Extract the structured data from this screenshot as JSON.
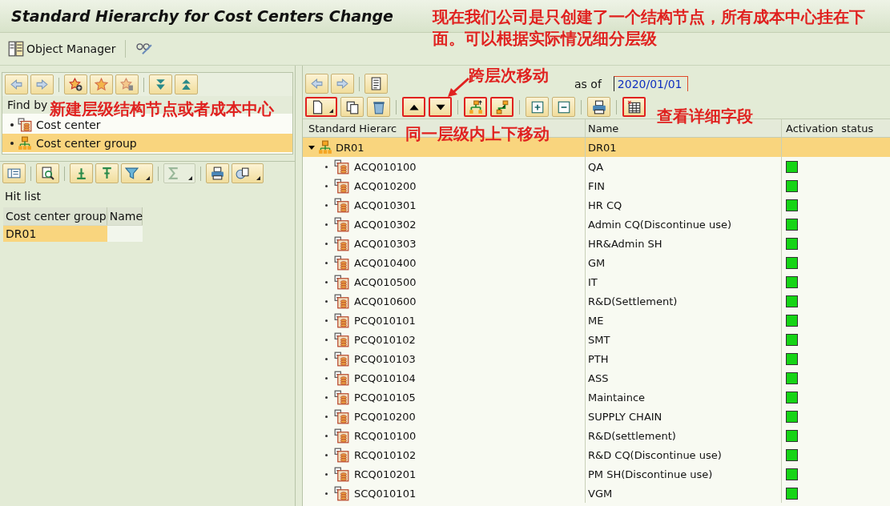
{
  "window": {
    "title": "Standard Hierarchy for Cost Centers Change"
  },
  "app_toolbar": {
    "object_manager": "Object Manager"
  },
  "find_panel": {
    "label": "Find by",
    "items": [
      {
        "label": "Cost center",
        "selected": false
      },
      {
        "label": "Cost center group",
        "selected": true
      }
    ]
  },
  "hit_list": {
    "title": "Hit list",
    "columns": [
      "Cost center group",
      "Name"
    ],
    "rows": [
      {
        "group": "DR01",
        "selected": true
      }
    ]
  },
  "hierarchy": {
    "as_of_label": "as of",
    "date": "2020/01/01",
    "toolbar": [
      {
        "highlighted": true
      },
      {
        "highlighted": false
      },
      {
        "highlighted": false
      },
      {
        "highlighted": true
      },
      {
        "highlighted": true
      },
      {
        "highlighted": true
      },
      {
        "highlighted": true
      },
      {
        "highlighted": false
      },
      {
        "highlighted": false
      },
      {
        "highlighted": false
      },
      {
        "highlighted": true
      }
    ],
    "columns": [
      "Standard Hierarc",
      "Name",
      "Activation status"
    ],
    "root": {
      "code": "DR01",
      "name": "DR01",
      "expanded": true,
      "selected": true,
      "children": [
        {
          "code": "ACQ010100",
          "name": "QA",
          "active": true
        },
        {
          "code": "ACQ010200",
          "name": "FIN",
          "active": true
        },
        {
          "code": "ACQ010301",
          "name": "HR CQ",
          "active": true
        },
        {
          "code": "ACQ010302",
          "name": "Admin CQ(Discontinue use)",
          "active": true
        },
        {
          "code": "ACQ010303",
          "name": "HR&Admin SH",
          "active": true
        },
        {
          "code": "ACQ010400",
          "name": "GM",
          "active": true
        },
        {
          "code": "ACQ010500",
          "name": "IT",
          "active": true
        },
        {
          "code": "ACQ010600",
          "name": "R&D(Settlement)",
          "active": true
        },
        {
          "code": "PCQ010101",
          "name": "ME",
          "active": true
        },
        {
          "code": "PCQ010102",
          "name": "SMT",
          "active": true
        },
        {
          "code": "PCQ010103",
          "name": "PTH",
          "active": true
        },
        {
          "code": "PCQ010104",
          "name": "ASS",
          "active": true
        },
        {
          "code": "PCQ010105",
          "name": "Maintaince",
          "active": true
        },
        {
          "code": "PCQ010200",
          "name": "SUPPLY CHAIN",
          "active": true
        },
        {
          "code": "RCQ010100",
          "name": "R&D(settlement)",
          "active": true
        },
        {
          "code": "RCQ010102",
          "name": "R&D CQ(Discontinue use)",
          "active": true
        },
        {
          "code": "RCQ010201",
          "name": "PM SH(Discontinue use)",
          "active": true
        },
        {
          "code": "SCQ010101",
          "name": "VGM",
          "active": true
        }
      ]
    }
  },
  "annotations": [
    {
      "text": "现在我们公司是只创建了一个结构节点，所有成本中心挂在下面。可以根据实际情况细分层级"
    },
    {
      "text": "新建层级结构节点或者成本中心"
    },
    {
      "text": "跨层次移动"
    },
    {
      "text": "同一层级内上下移动"
    },
    {
      "text": "查看详细字段"
    }
  ]
}
